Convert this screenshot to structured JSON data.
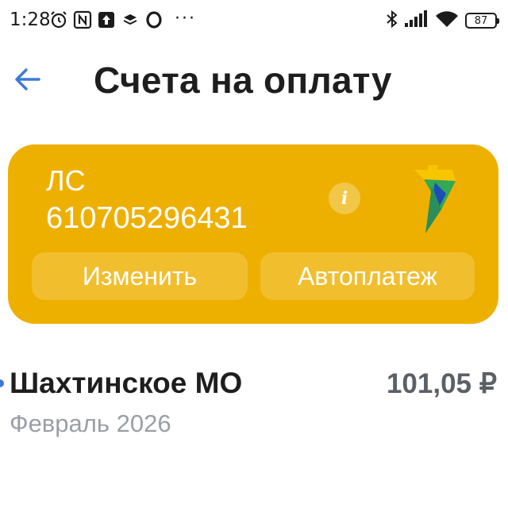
{
  "status_bar": {
    "time": "1:28",
    "left_icons": [
      "alarm-icon",
      "nfc-icon",
      "upload-icon",
      "layers-icon",
      "opera-icon"
    ],
    "more": "···",
    "right_icons": [
      "bluetooth-icon",
      "signal-icon",
      "wifi-icon"
    ],
    "battery": "87"
  },
  "header": {
    "title": "Счета на оплату",
    "back_icon": "arrow-left-icon"
  },
  "account_card": {
    "label": "ЛС",
    "number": "610705296431",
    "info_icon_text": "i",
    "change_button": "Изменить",
    "autopay_button": "Автоплатеж",
    "colors": {
      "background": "#eeb000",
      "logo_yellow": "#f7c600",
      "logo_green": "#34a853",
      "logo_blue": "#1f4bb8"
    }
  },
  "invoices": [
    {
      "name": "Шахтинское МО",
      "amount": "101,05 ₽",
      "period": "Февраль 2026"
    }
  ],
  "colors": {
    "accent": "#3c7ad8",
    "title_text": "#1e1e1e",
    "muted_text": "#9a9fa6"
  }
}
